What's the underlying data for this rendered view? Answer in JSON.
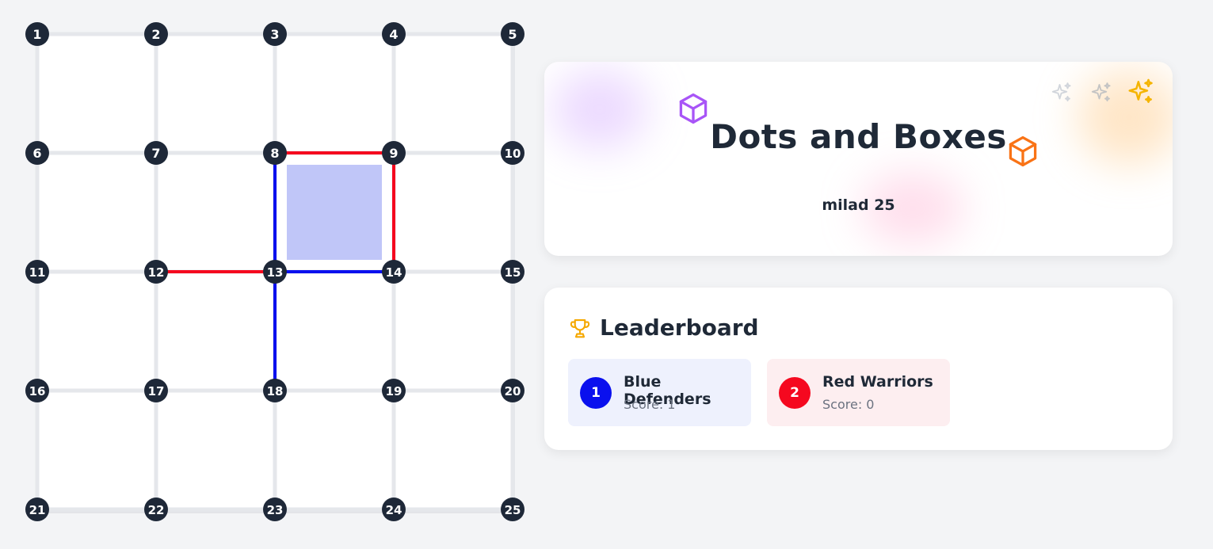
{
  "game": {
    "title": "Dots and Boxes",
    "subtitle": "milad 25",
    "grid": {
      "rows": 5,
      "cols": 5
    },
    "dots": [
      "1",
      "2",
      "3",
      "4",
      "5",
      "6",
      "7",
      "8",
      "9",
      "10",
      "11",
      "12",
      "13",
      "14",
      "15",
      "16",
      "17",
      "18",
      "19",
      "20",
      "21",
      "22",
      "23",
      "24",
      "25"
    ],
    "drawn_lines": [
      {
        "from": 8,
        "to": 9,
        "owner": "red"
      },
      {
        "from": 9,
        "to": 14,
        "owner": "red"
      },
      {
        "from": 8,
        "to": 13,
        "owner": "blue"
      },
      {
        "from": 13,
        "to": 14,
        "owner": "blue"
      },
      {
        "from": 12,
        "to": 13,
        "owner": "red"
      },
      {
        "from": 13,
        "to": 18,
        "owner": "blue"
      }
    ],
    "claimed_boxes": [
      {
        "top_left_dot": 8,
        "owner": "blue"
      }
    ]
  },
  "colors": {
    "blue": "#0a10ee",
    "red": "#f5081f",
    "blue_box": "#c0c6f8",
    "dot": "#1e2838",
    "empty_line": "#e5e7eb"
  },
  "leaderboard": {
    "title": "Leaderboard",
    "icon": "trophy-icon",
    "teams": [
      {
        "rank": "1",
        "name": "Blue Defenders",
        "score_text": "Score: 1"
      },
      {
        "rank": "2",
        "name": "Red Warriors",
        "score_text": "Score: 0"
      }
    ]
  },
  "decorations": [
    "cube-icon",
    "cube-icon",
    "sparkle-icon",
    "sparkle-icon",
    "sparkle-icon"
  ]
}
